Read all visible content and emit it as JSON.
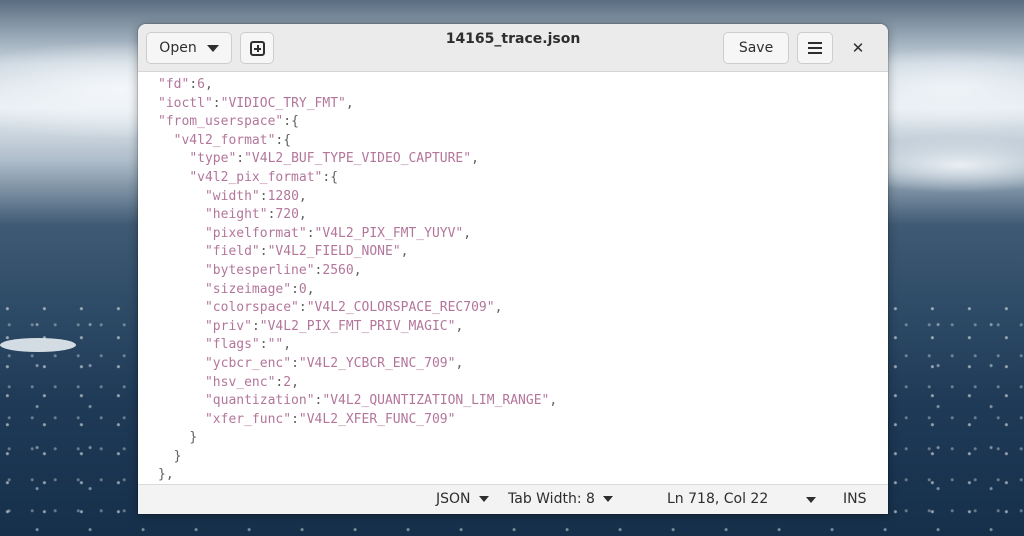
{
  "window": {
    "title": "14165_trace.json"
  },
  "headerbar": {
    "open_label": "Open",
    "save_label": "Save",
    "new_tab_icon": "new-tab-icon",
    "menu_icon": "hamburger-menu-icon",
    "close_glyph": "✕"
  },
  "editor": {
    "lines": [
      {
        "indent": 0,
        "key": "\"fd\"",
        "sep": ":",
        "value": "6",
        "value_type": "number",
        "tail": ","
      },
      {
        "indent": 0,
        "key": "\"ioctl\"",
        "sep": ":",
        "value": "\"VIDIOC_TRY_FMT\"",
        "value_type": "string",
        "tail": ","
      },
      {
        "indent": 0,
        "key": "\"from_userspace\"",
        "sep": ":",
        "value": "",
        "value_type": "none",
        "tail": "{"
      },
      {
        "indent": 2,
        "key": "\"v4l2_format\"",
        "sep": ":",
        "value": "",
        "value_type": "none",
        "tail": "{"
      },
      {
        "indent": 4,
        "key": "\"type\"",
        "sep": ":",
        "value": "\"V4L2_BUF_TYPE_VIDEO_CAPTURE\"",
        "value_type": "string",
        "tail": ","
      },
      {
        "indent": 4,
        "key": "\"v4l2_pix_format\"",
        "sep": ":",
        "value": "",
        "value_type": "none",
        "tail": "{"
      },
      {
        "indent": 6,
        "key": "\"width\"",
        "sep": ":",
        "value": "1280",
        "value_type": "number",
        "tail": ","
      },
      {
        "indent": 6,
        "key": "\"height\"",
        "sep": ":",
        "value": "720",
        "value_type": "number",
        "tail": ","
      },
      {
        "indent": 6,
        "key": "\"pixelformat\"",
        "sep": ":",
        "value": "\"V4L2_PIX_FMT_YUYV\"",
        "value_type": "string",
        "tail": ","
      },
      {
        "indent": 6,
        "key": "\"field\"",
        "sep": ":",
        "value": "\"V4L2_FIELD_NONE\"",
        "value_type": "string",
        "tail": ","
      },
      {
        "indent": 6,
        "key": "\"bytesperline\"",
        "sep": ":",
        "value": "2560",
        "value_type": "number",
        "tail": ","
      },
      {
        "indent": 6,
        "key": "\"sizeimage\"",
        "sep": ":",
        "value": "0",
        "value_type": "number",
        "tail": ","
      },
      {
        "indent": 6,
        "key": "\"colorspace\"",
        "sep": ":",
        "value": "\"V4L2_COLORSPACE_REC709\"",
        "value_type": "string",
        "tail": ","
      },
      {
        "indent": 6,
        "key": "\"priv\"",
        "sep": ":",
        "value": "\"V4L2_PIX_FMT_PRIV_MAGIC\"",
        "value_type": "string",
        "tail": ","
      },
      {
        "indent": 6,
        "key": "\"flags\"",
        "sep": ":",
        "value": "\"\"",
        "value_type": "string",
        "tail": ","
      },
      {
        "indent": 6,
        "key": "\"ycbcr_enc\"",
        "sep": ":",
        "value": "\"V4L2_YCBCR_ENC_709\"",
        "value_type": "string",
        "tail": ","
      },
      {
        "indent": 6,
        "key": "\"hsv_enc\"",
        "sep": ":",
        "value": "2",
        "value_type": "number",
        "tail": ","
      },
      {
        "indent": 6,
        "key": "\"quantization\"",
        "sep": ":",
        "value": "\"V4L2_QUANTIZATION_LIM_RANGE\"",
        "value_type": "string",
        "tail": ","
      },
      {
        "indent": 6,
        "key": "\"xfer_func\"",
        "sep": ":",
        "value": "\"V4L2_XFER_FUNC_709\"",
        "value_type": "string",
        "tail": ""
      },
      {
        "indent": 4,
        "key": "",
        "sep": "",
        "value": "",
        "value_type": "none",
        "tail": "}"
      },
      {
        "indent": 2,
        "key": "",
        "sep": "",
        "value": "",
        "value_type": "none",
        "tail": "}"
      },
      {
        "indent": 0,
        "key": "",
        "sep": "",
        "value": "",
        "value_type": "none",
        "tail": "},"
      }
    ]
  },
  "statusbar": {
    "language": "JSON",
    "tab_width": "Tab Width: 8",
    "position": "Ln 718, Col 22",
    "mode": "INS"
  },
  "colors": {
    "key": "#b3769b",
    "string": "#b3769b",
    "number": "#b3769b",
    "punctuation": "#5f5f5f"
  }
}
